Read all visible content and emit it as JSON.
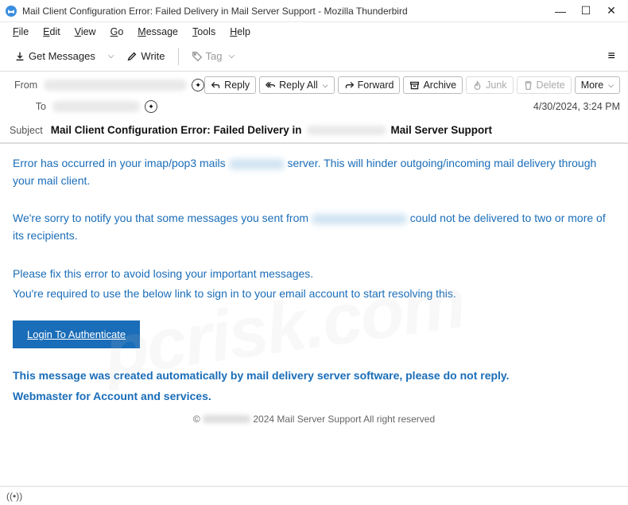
{
  "window": {
    "title": "Mail Client Configuration Error: Failed Delivery in                          Mail Server Support - Mozilla Thunderbird"
  },
  "menubar": [
    "File",
    "Edit",
    "View",
    "Go",
    "Message",
    "Tools",
    "Help"
  ],
  "toolbar": {
    "get_messages": "Get Messages",
    "write": "Write",
    "tag": "Tag"
  },
  "actions": {
    "reply": "Reply",
    "reply_all": "Reply All",
    "forward": "Forward",
    "archive": "Archive",
    "junk": "Junk",
    "delete": "Delete",
    "more": "More"
  },
  "headers": {
    "from_label": "From",
    "to_label": "To",
    "subject_label": "Subject",
    "subject_prefix": "Mail Client Configuration Error: Failed Delivery in",
    "subject_suffix": "Mail Server Support",
    "date": "4/30/2024, 3:24 PM"
  },
  "body": {
    "p1a": "Error has occurred in your imap/pop3 mails",
    "p1b": "server. This will hinder outgoing/incoming mail delivery through your mail client.",
    "p2a": "We're sorry to notify you that some messages you sent from",
    "p2b": "could not be delivered to two or more of its recipients.",
    "p3": "Please fix this error to avoid losing your important messages.",
    "p4": "You're required to use the below link to sign in to your email account to start resolving this.",
    "login_button": "Login To Authenticate",
    "footer1": "This message was created automatically by mail delivery server software, please do not reply.",
    "footer2": "Webmaster for Account and services.",
    "copyright": "2024 Mail Server Support All right reserved"
  },
  "statusbar": {
    "text": "((•))"
  }
}
